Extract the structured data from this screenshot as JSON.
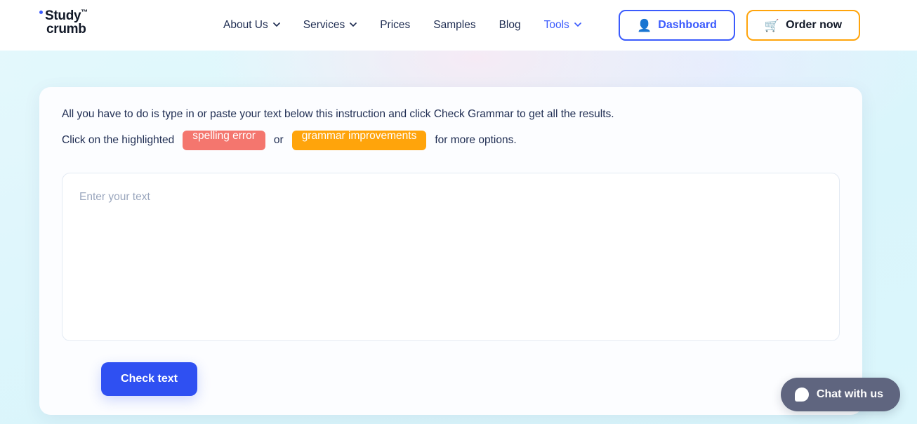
{
  "header": {
    "logo": {
      "line1": "Study",
      "tm": "™",
      "line2": "crumb",
      "dot_color": "#3b5bfd"
    },
    "nav": [
      {
        "label": "About Us",
        "has_dropdown": true,
        "active": false
      },
      {
        "label": "Services",
        "has_dropdown": true,
        "active": false
      },
      {
        "label": "Prices",
        "has_dropdown": false,
        "active": false
      },
      {
        "label": "Samples",
        "has_dropdown": false,
        "active": false
      },
      {
        "label": "Blog",
        "has_dropdown": false,
        "active": false
      },
      {
        "label": "Tools",
        "has_dropdown": true,
        "active": true
      }
    ],
    "dashboard_button": {
      "label": "Dashboard",
      "icon": "user-bust-icon",
      "glyph": "👤",
      "border_color": "#3b5bfd",
      "text_color": "#3b5bfd"
    },
    "order_button": {
      "label": "Order now",
      "icon": "shopping-cart-icon",
      "glyph": "🛒",
      "border_color": "#ffa40b",
      "text_color": "#111827"
    }
  },
  "main": {
    "instruction_1": "All you have to do is type in or paste your text below this instruction and click Check Grammar to get all the results.",
    "instruction_2": {
      "prefix": "Click on the highlighted",
      "badge_spelling": "spelling error",
      "conjunction": "or",
      "badge_grammar": "grammar improvements",
      "suffix": "for more options."
    },
    "editor": {
      "placeholder": "Enter your text",
      "value": ""
    },
    "check_button": "Check text"
  },
  "chat": {
    "label": "Chat with us",
    "icon": "chat-bubble-icon",
    "background": "#5f657f"
  },
  "colors": {
    "accent_blue": "#3b5bfd",
    "primary_button": "#2f50f2",
    "spelling_badge": "#f4766e",
    "grammar_badge": "#ffa40b",
    "text_dark": "#1f2d52",
    "page_bg_cyan": "#dff6fc"
  }
}
